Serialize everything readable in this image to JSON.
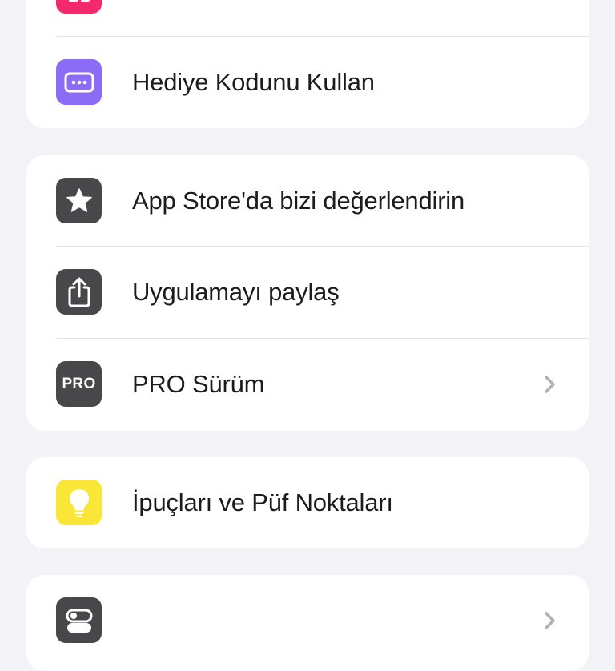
{
  "groups": [
    {
      "id": "gifts",
      "items": [
        {
          "label": "",
          "icon": "gift-icon",
          "icon_bg": "#f3296e",
          "chevron": false
        },
        {
          "label": "Hediye Kodunu Kullan",
          "icon": "ellipsis-card-icon",
          "icon_bg": "#8b6cf6",
          "chevron": false
        }
      ]
    },
    {
      "id": "app",
      "items": [
        {
          "label": "App Store'da bizi değerlendirin",
          "icon": "star-icon",
          "icon_bg": "#48484a",
          "chevron": false
        },
        {
          "label": "Uygulamayı paylaş",
          "icon": "share-icon",
          "icon_bg": "#48484a",
          "chevron": false
        },
        {
          "label": "PRO Sürüm",
          "icon": "pro-badge-icon",
          "icon_text": "PRO",
          "icon_bg": "#48484a",
          "chevron": true
        }
      ]
    },
    {
      "id": "tips",
      "items": [
        {
          "label": "İpuçları ve Püf Noktaları",
          "icon": "lightbulb-icon",
          "icon_bg": "#f9e636",
          "chevron": false
        }
      ]
    },
    {
      "id": "general",
      "items": [
        {
          "label": "",
          "icon": "toggle-icon",
          "icon_bg": "#48484a",
          "chevron": true
        }
      ]
    }
  ],
  "colors": {
    "background": "#f2f2f7",
    "card": "#ffffff",
    "separator": "#e3e3e8",
    "chevron": "#b0b0b6"
  }
}
